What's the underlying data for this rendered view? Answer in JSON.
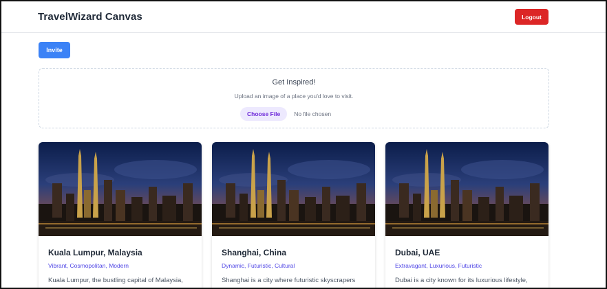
{
  "header": {
    "title": "TravelWizard Canvas",
    "logout_label": "Logout"
  },
  "toolbar": {
    "invite_label": "Invite"
  },
  "upload": {
    "title": "Get Inspired!",
    "subtitle": "Upload an image of a place you'd love to visit.",
    "choose_file_label": "Choose File",
    "file_status": "No file chosen"
  },
  "cards": [
    {
      "title": "Kuala Lumpur, Malaysia",
      "tags": "Vibrant, Cosmopolitan, Modern",
      "description": "Kuala Lumpur, the bustling capital of Malaysia,"
    },
    {
      "title": "Shanghai, China",
      "tags": "Dynamic, Futuristic, Cultural",
      "description": "Shanghai is a city where futuristic skyscrapers"
    },
    {
      "title": "Dubai, UAE",
      "tags": "Extravagant, Luxurious, Futuristic",
      "description": "Dubai is a city known for its luxurious lifestyle,"
    }
  ],
  "colors": {
    "logout": "#dc2626",
    "invite": "#3b82f6",
    "tag_text": "#4f46e5",
    "choose_file_bg": "#ede9fe"
  },
  "icons": {
    "card_image": "city-skyline-night-image"
  }
}
